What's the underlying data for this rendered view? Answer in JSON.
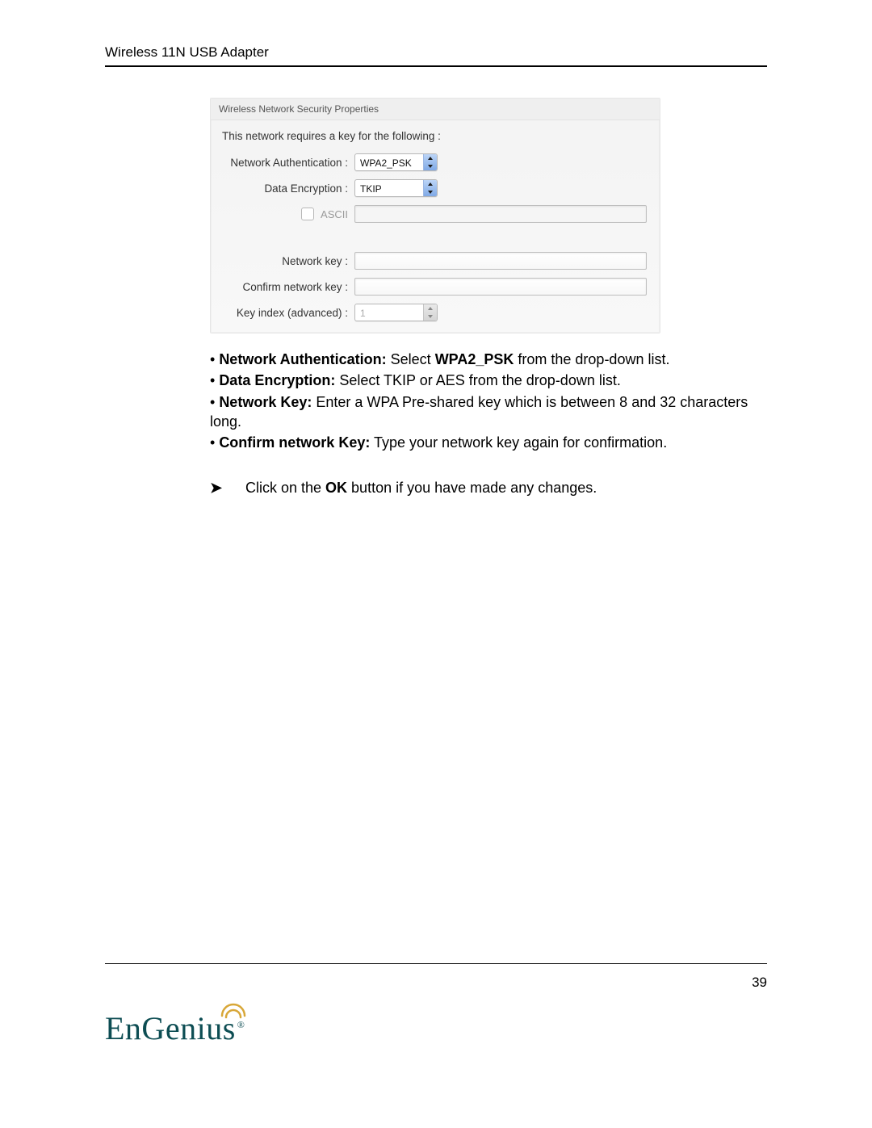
{
  "header": {
    "title": "Wireless 11N USB Adapter"
  },
  "panel": {
    "title": "Wireless Network Security Properties",
    "intro": "This network requires a key for the following :",
    "labels": {
      "auth": "Network Authentication :",
      "encryption": "Data Encryption :",
      "ascii": "ASCII",
      "netkey": "Network key :",
      "confirm": "Confirm network key :",
      "keyindex": "Key index (advanced) :"
    },
    "values": {
      "auth": "WPA2_PSK",
      "encryption": "TKIP",
      "keyindex": "1"
    }
  },
  "instructions": {
    "b1_bold": "Network Authentication:",
    "b1_rest_a": " Select ",
    "b1_bold2": "WPA2_PSK",
    "b1_rest_b": " from the drop-down list.",
    "b2_bold": "Data Encryption:",
    "b2_rest": " Select TKIP or AES from the drop-down list.",
    "b3_bold": "Network Key:",
    "b3_rest": " Enter a WPA Pre-shared key which is between 8 and 32 characters long.",
    "b4_bold": "Confirm network Key:",
    "b4_rest": " Type your network key again for confirmation.",
    "arrow_a": "Click on the ",
    "arrow_bold": "OK",
    "arrow_b": " button if you have made any changes."
  },
  "footer": {
    "page": "39",
    "logo": "EnGenius",
    "reg": "®"
  }
}
